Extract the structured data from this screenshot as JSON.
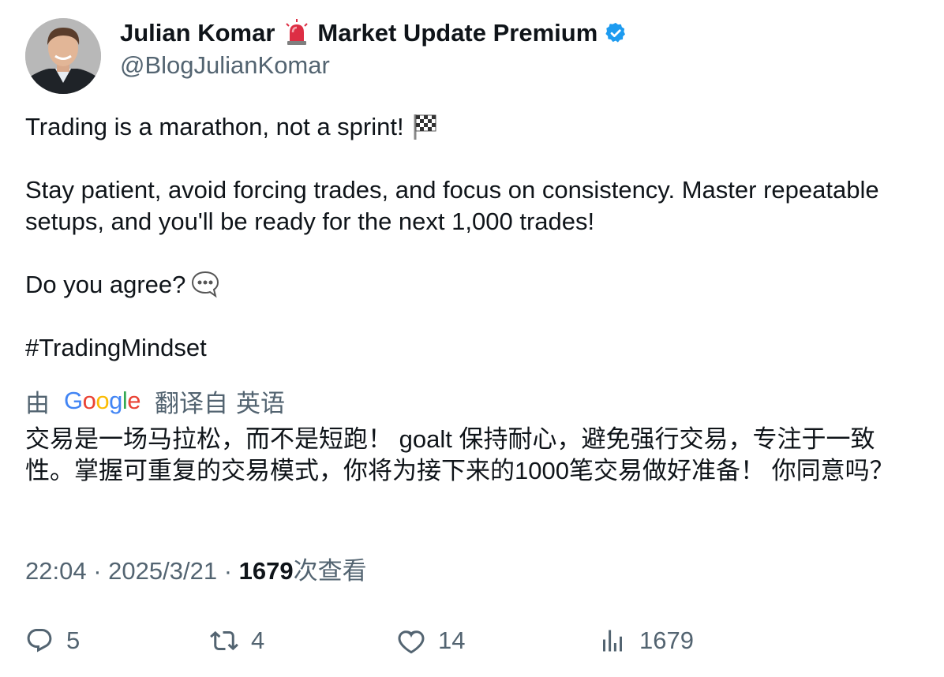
{
  "author": {
    "display_name_part1": "Julian Komar",
    "display_name_part2": "Market Update Premium",
    "handle": "@BlogJulianKomar",
    "verified_color": "#1d9bf0"
  },
  "tweet": {
    "line1": "Trading is a marathon, not a sprint!",
    "line2": "Stay patient, avoid forcing trades, and focus on consistency. Master repeatable setups, and you'll be ready for the next 1,000 trades!",
    "line3": "Do you agree?",
    "hashtag": "#TradingMindset"
  },
  "translation": {
    "prefix": "由",
    "google_letters": [
      "G",
      "o",
      "o",
      "g",
      "l",
      "e"
    ],
    "suffix1": "翻译自",
    "suffix2": "英语",
    "text": "交易是一场马拉松，而不是短跑！ goalt 保持耐心，避免强行交易，专注于一致性。掌握可重复的交易模式，你将为接下来的1000笔交易做好准备！ 你同意吗？"
  },
  "meta": {
    "time": "22:04",
    "separator": "·",
    "date": "2025/3/21",
    "views_count": "1679",
    "views_label": "次查看"
  },
  "actions": {
    "replies": "5",
    "retweets": "4",
    "likes": "14",
    "views": "1679"
  }
}
